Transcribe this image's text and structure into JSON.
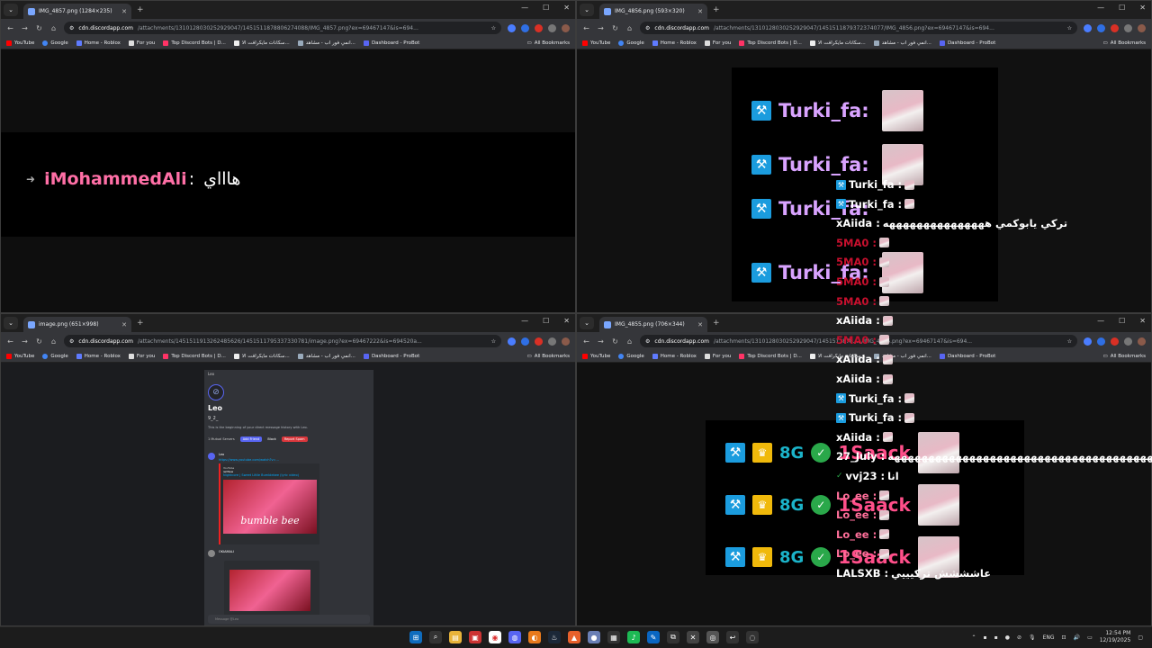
{
  "bookmarks": [
    "YouTube",
    "Google",
    "Home - Roblox",
    "For you",
    "Top Discord Bots | D...",
    "سكانات مايكرافت الا...",
    "انمي فور اب - مشاهد...",
    "Dashboard - ProBot"
  ],
  "all_bookmarks_label": "All Bookmarks",
  "windows": {
    "w1": {
      "tab_title": "IMG_4857.png (1284×235)",
      "host": "cdn.discordapp.com",
      "path": "/attachments/1310128030252929047/1451511878806274088/IMG_4857.png?ex=69467147&is=694..."
    },
    "w2": {
      "tab_title": "IMG_4856.png (593×320)",
      "host": "cdn.discordapp.com",
      "path": "/attachments/1310128030252929047/1451511879372374077/IMG_4856.png?ex=69467147&is=694..."
    },
    "w3": {
      "tab_title": "image.png (651×998)",
      "host": "cdn.discordapp.com",
      "path": "/attachments/1451511913262485626/1451511795337330781/image.png?ex=69467222&is=694520a..."
    },
    "w4": {
      "tab_title": "IMG_4855.png (706×344)",
      "host": "cdn.discordapp.com",
      "path": "/attachments/1310128030252929047/1451511878...../IMG_4855.png?ex=69467147&is=694..."
    }
  },
  "w1_message": {
    "name": "iMohammedAli",
    "sep": ":",
    "text": "هاااي"
  },
  "w2_lines": [
    "Turki_fa:",
    "Turki_fa:",
    "Turki_fa:",
    "Turki_fa:"
  ],
  "overlay_chat": [
    {
      "name": "Turki_fa :",
      "color": "#ffffff",
      "badge": true,
      "avatar": true
    },
    {
      "name": "Turki_fa :",
      "color": "#ffffff",
      "badge": true,
      "avatar": true
    },
    {
      "name": "xAiida :",
      "color": "#ffffff",
      "text": "تركي يابوكمي هههههههههههههههه",
      "avatar": false
    },
    {
      "name": "5MA0 :",
      "color": "#c8102e",
      "avatar": true
    },
    {
      "name": "5MA0 :",
      "color": "#c8102e",
      "avatar": true
    },
    {
      "name": "5MA0 :",
      "color": "#c8102e",
      "avatar": true
    },
    {
      "name": "5MA0 :",
      "color": "#c8102e",
      "avatar": true
    },
    {
      "name": "xAiida :",
      "color": "#ffffff",
      "avatar": true
    },
    {
      "name": "5MA0 :",
      "color": "#c8102e",
      "avatar": true
    },
    {
      "name": "xAiida :",
      "color": "#ffffff",
      "avatar": true
    },
    {
      "name": "xAiida :",
      "color": "#ffffff",
      "avatar": true
    },
    {
      "name": "Turki_fa :",
      "color": "#ffffff",
      "badge": true,
      "avatar": true
    },
    {
      "name": "Turki_fa :",
      "color": "#ffffff",
      "badge": true,
      "avatar": true
    },
    {
      "name": "xAiida :",
      "color": "#ffffff",
      "avatar": true
    },
    {
      "name": "27_July :",
      "color": "#ffffff",
      "text": "هههههههههههههههههههههههههههههههههههههههههههه"
    },
    {
      "name": "vvj23 :",
      "color": "#ffffff",
      "text": "انا",
      "check": true
    },
    {
      "name": "Lo_ee :",
      "color": "#ff6f9a",
      "avatar": true
    },
    {
      "name": "Lo_ee :",
      "color": "#ff6f9a",
      "avatar": true
    },
    {
      "name": "Lo_ee :",
      "color": "#ff6f9a",
      "avatar": true
    },
    {
      "name": "Lo_ee :",
      "color": "#ff6f9a",
      "avatar": true
    },
    {
      "name": "LALSXB :",
      "color": "#ffffff",
      "text": "عاشششش تركيييي"
    }
  ],
  "w4_names": [
    "1Saack",
    "1Saack",
    "1Saack"
  ],
  "w4_tags": [
    "8G",
    "8G",
    "8G"
  ],
  "discord": {
    "username": "Leo",
    "tag": "9_2_",
    "intro": "This is the beginning of your direct message history with Leo.",
    "mutual": "1 Mutual Servers",
    "add_friend": "Add Friend",
    "block": "Block",
    "report": "Report Spam",
    "link": "https://www.youtube.com/watch?v=...",
    "embed_site": "YouTube",
    "embed_author": "iwiWew",
    "embed_title": "Nightcore | Sweet Little Bumblebee (lyric video)",
    "embed_text": "bumble bee",
    "msg_author": "OKIAMALI",
    "input_placeholder": "Message @Leo"
  },
  "taskbar": {
    "lang": "ENG",
    "time": "12:54 PM",
    "date": "12/19/2025"
  }
}
